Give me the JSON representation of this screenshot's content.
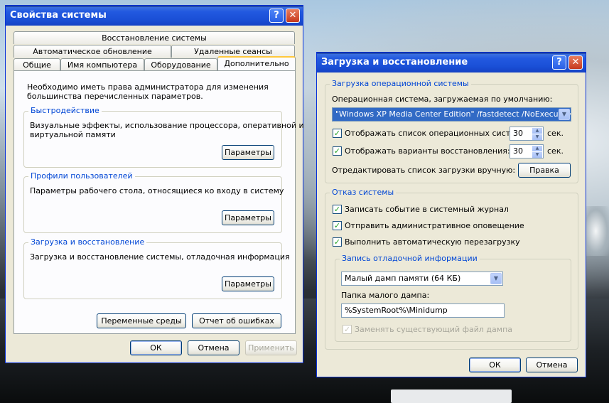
{
  "sysprops": {
    "title": "Свойства системы",
    "help": "?",
    "close": "✕",
    "tabs_row1": [
      "Восстановление системы"
    ],
    "tabs_row2": [
      "Автоматическое обновление",
      "Удаленные сеансы"
    ],
    "tabs_row3": [
      "Общие",
      "Имя компьютера",
      "Оборудование",
      "Дополнительно"
    ],
    "intro": [
      "Необходимо иметь права администратора для изменения",
      "большинства перечисленных параметров."
    ],
    "perf": {
      "legend": "Быстродействие",
      "text": [
        "Визуальные эффекты, использование процессора, оперативной и",
        "виртуальной памяти"
      ],
      "button": "Параметры"
    },
    "profiles": {
      "legend": "Профили пользователей",
      "text": "Параметры рабочего стола, относящиеся ко входу в систему",
      "button": "Параметры"
    },
    "startup": {
      "legend": "Загрузка и восстановление",
      "text": "Загрузка и восстановление системы, отладочная информация",
      "button": "Параметры"
    },
    "env_button": "Переменные среды",
    "err_button": "Отчет об ошибках",
    "ok": "ОК",
    "cancel": "Отмена",
    "apply": "Применить"
  },
  "startup": {
    "title": "Загрузка и восстановление",
    "help": "?",
    "close": "✕",
    "boot_group": "Загрузка операционной системы",
    "default_os_label": "Операционная система, загружаемая по умолчанию:",
    "default_os_value": "\"Windows XP Media Center Edition\" /fastdetect /NoExecute=OptI",
    "show_list_label": "Отображать список операционных систем:",
    "show_list_value": "30",
    "show_recovery_label": "Отображать варианты восстановления:",
    "show_recovery_value": "30",
    "sec": "сек.",
    "edit_label": "Отредактировать список загрузки вручную:",
    "edit_button": "Правка",
    "failure_group": "Отказ системы",
    "write_event": "Записать событие в системный журнал",
    "send_alert": "Отправить административное оповещение",
    "auto_restart": "Выполнить автоматическую перезагрузку",
    "debug_group": "Запись отладочной информации",
    "dump_type": "Малый дамп памяти (64 КБ)",
    "dump_folder_label": "Папка малого дампа:",
    "dump_folder_value": "%SystemRoot%\\Minidump",
    "overwrite": "Заменять существующий файл дампа",
    "ok": "ОК",
    "cancel": "Отмена"
  },
  "colors": {
    "titlebar": "#2259e0",
    "close": "#c6391e",
    "legend": "#0046d5",
    "face": "#ece9d8",
    "tab_highlight": "#ffc83c"
  }
}
